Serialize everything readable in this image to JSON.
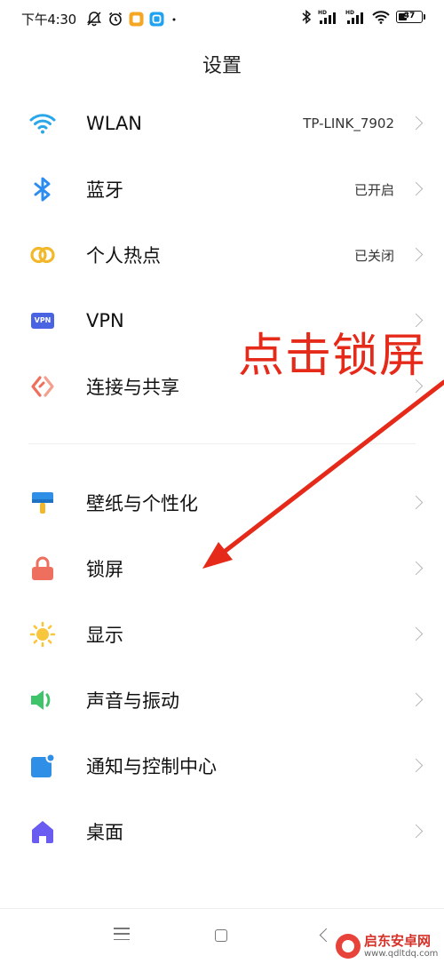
{
  "status_bar": {
    "time": "下午4:30",
    "battery": "37",
    "battery_level": 0.37
  },
  "header": {
    "title": "设置"
  },
  "settings": [
    {
      "id": "wlan",
      "label": "WLAN",
      "value": "TP-LINK_7902",
      "icon": "wifi-icon",
      "color": "#2aa7e8"
    },
    {
      "id": "bluetooth",
      "label": "蓝牙",
      "value": "已开启",
      "icon": "bluetooth-icon",
      "color": "#2b8df0"
    },
    {
      "id": "hotspot",
      "label": "个人热点",
      "value": "已关闭",
      "icon": "hotspot-icon",
      "color": "#f3b82a"
    },
    {
      "id": "vpn",
      "label": "VPN",
      "value": "",
      "icon": "vpn-icon",
      "icon_text": "VPN",
      "color": "#4a63e3"
    },
    {
      "id": "connection-sharing",
      "label": "连接与共享",
      "value": "",
      "icon": "connection-icon",
      "color": "#ee6f5d"
    },
    {
      "id": "wallpaper",
      "label": "壁纸与个性化",
      "value": "",
      "icon": "wallpaper-icon",
      "color": "#2f8fe6"
    },
    {
      "id": "lock-screen",
      "label": "锁屏",
      "value": "",
      "icon": "lock-icon",
      "color": "#ee6f5d"
    },
    {
      "id": "display",
      "label": "显示",
      "value": "",
      "icon": "sun-icon",
      "color": "#f8c63c"
    },
    {
      "id": "sound",
      "label": "声音与振动",
      "value": "",
      "icon": "speaker-icon",
      "color": "#40c46a"
    },
    {
      "id": "notifications",
      "label": "通知与控制中心",
      "value": "",
      "icon": "notification-icon",
      "color": "#2f8fe6"
    },
    {
      "id": "home-screen",
      "label": "桌面",
      "value": "",
      "icon": "home-icon",
      "color": "#6a5cf0"
    }
  ],
  "annotation": {
    "text": "点击锁屏",
    "color": "#e52a1a"
  },
  "watermark": {
    "name": "启东安卓网",
    "url": "www.qdltdq.com"
  }
}
